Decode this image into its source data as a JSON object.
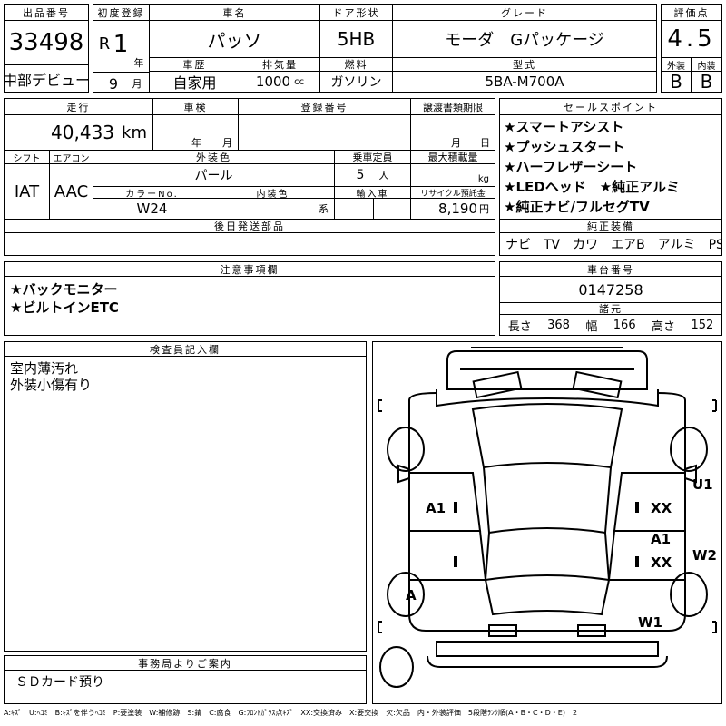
{
  "lot": {
    "label": "出品番号",
    "number": "33498",
    "event": "中部デビュー"
  },
  "first_reg": {
    "label": "初度登録",
    "era": "R",
    "year": "1",
    "year_unit": "年",
    "month": "9",
    "month_unit": "月"
  },
  "car_name": {
    "label": "車名",
    "value": "パッソ"
  },
  "door": {
    "label": "ドア形状",
    "value": "5HB"
  },
  "grade": {
    "label": "グレード",
    "value": "モーダ　Gパッケージ"
  },
  "score": {
    "label": "評価点",
    "value": "4.5",
    "exterior_label": "外装",
    "exterior": "B",
    "interior_label": "内装",
    "interior": "B"
  },
  "history": {
    "label": "車歴",
    "value": "自家用"
  },
  "displacement": {
    "label": "排気量",
    "value": "1000",
    "unit": "cc"
  },
  "fuel": {
    "label": "燃料",
    "value": "ガソリン"
  },
  "model": {
    "label": "型式",
    "value": "5BA-M700A"
  },
  "mileage": {
    "label": "走行",
    "value": "40,433",
    "unit": "km"
  },
  "inspection": {
    "label": "車検",
    "year_unit": "年",
    "month_unit": "月"
  },
  "registration": {
    "label": "登録番号"
  },
  "transfer": {
    "label": "譲渡書類期限",
    "month_unit": "月",
    "day_unit": "日"
  },
  "shift": {
    "label": "シフト",
    "value": "IAT"
  },
  "aircon": {
    "label": "エアコン",
    "value": "AAC"
  },
  "ext_color": {
    "label": "外装色",
    "value": "パール"
  },
  "capacity": {
    "label": "乗車定員",
    "value": "5",
    "unit": "人"
  },
  "load": {
    "label": "最大積載量",
    "unit": "kg"
  },
  "color_no": {
    "label": "カラーNo.",
    "value": "W24"
  },
  "int_color": {
    "label": "内装色",
    "unit": "系"
  },
  "import": {
    "label": "輸入車"
  },
  "recycle": {
    "label": "リサイクル預託金",
    "value": "8,190",
    "unit": "円"
  },
  "later_parts": {
    "label": "後日発送部品"
  },
  "sales_points": {
    "label": "セールスポイント",
    "items": [
      "★スマートアシスト",
      "★プッシュスタート",
      "★ハーフレザーシート",
      "★LEDヘッド　★純正アルミ",
      "★純正ナビ/フルセグTV"
    ]
  },
  "equipment": {
    "label": "純正装備",
    "value": "ナビ　TV　カワ　エアB　アルミ　PS　PW"
  },
  "notes": {
    "label": "注意事項欄",
    "items": [
      "★バックモニター",
      "★ビルトインETC"
    ]
  },
  "chassis": {
    "label": "車台番号",
    "value": "0147258"
  },
  "specs": {
    "label": "諸元",
    "length_label": "長さ",
    "length": "368",
    "width_label": "幅",
    "width": "166",
    "height_label": "高さ",
    "height": "152"
  },
  "inspector": {
    "label": "検査員記入欄",
    "items": [
      "室内薄汚れ",
      "外装小傷有り"
    ]
  },
  "office": {
    "label": "事務局よりご案内",
    "value": "ＳＤカード預り"
  },
  "diagram": {
    "marks": {
      "a1_left": "A1",
      "xx_right_upper": "XX",
      "u1": "U1",
      "a1_right": "A1",
      "xx_right_lower": "XX",
      "w2": "W2",
      "a_wheel": "A",
      "w1": "W1"
    }
  },
  "legend": "A:ｷｽﾞ　U:ﾍｺﾐ　B:ｷｽﾞを伴うﾍｺﾐ　P:要塗装　W:補修跡　S:錆　C:腐食　G:ﾌﾛﾝﾄｶﾞﾗｽ点ｷｽﾞ　XX:交換済み　X:要交換　欠:欠品　内・外装評価　5段階ﾗﾝｸ順(A・B・C・D・E)　2"
}
